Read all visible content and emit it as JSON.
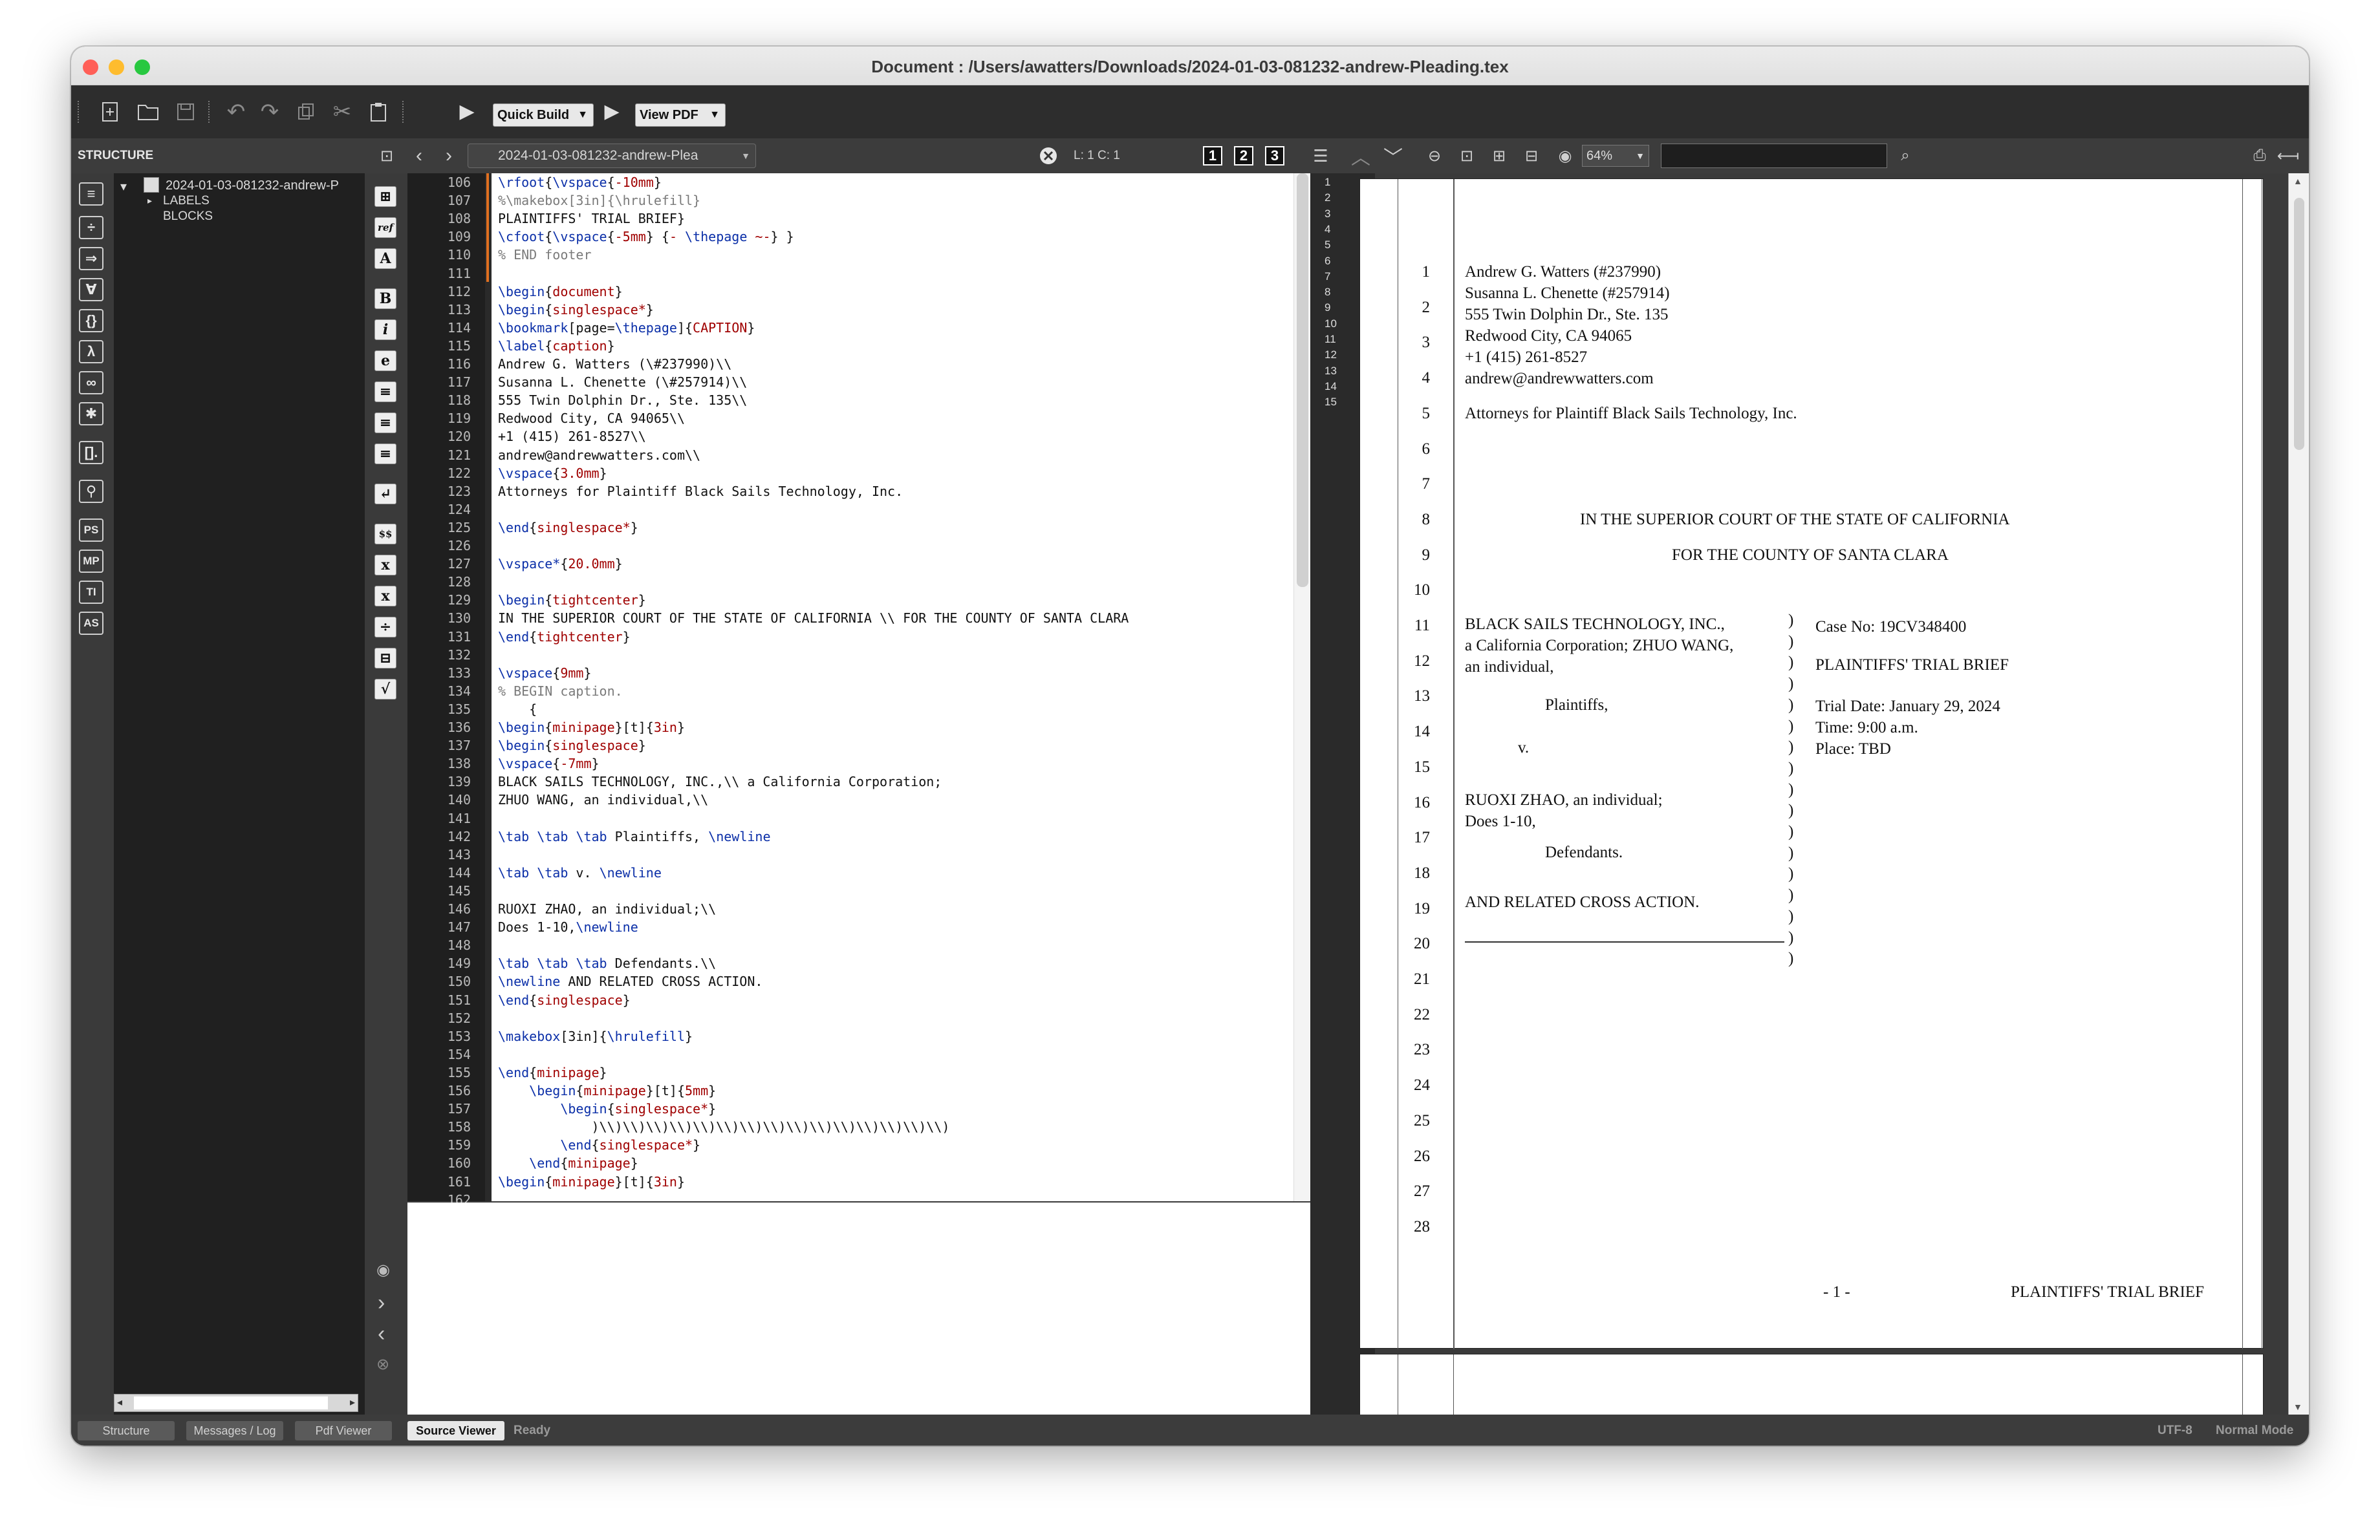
{
  "window": {
    "title": "Document : /Users/awatters/Downloads/2024-01-03-081232-andrew-Pleading.tex"
  },
  "toolbar": {
    "quick_build": "Quick Build",
    "view_pdf": "View PDF"
  },
  "sidebar": {
    "header": "STRUCTURE",
    "tree": {
      "file": "2024-01-03-081232-andrew-P",
      "labels": "LABELS",
      "blocks": "BLOCKS"
    },
    "icons": [
      "≡",
      "÷",
      "⇒",
      "∀",
      "{}",
      "λ",
      "∞",
      "✱",
      "[].",
      "⚲",
      "PS",
      "MP",
      "TI",
      "AS"
    ]
  },
  "editor": {
    "file_tab": "2024-01-03-081232-andrew-Plea",
    "position": "L: 1 C: 1",
    "latex_icons": [
      "⊞",
      "ref",
      "A",
      "B",
      "i",
      "e",
      "≡",
      "≡",
      "≡",
      "↵",
      "$$",
      "x",
      "x",
      "÷",
      "⊟",
      "√"
    ],
    "lines": [
      {
        "n": "106",
        "t": "\\rfoot{\\vspace{-10mm}"
      },
      {
        "n": "107",
        "t": "%\\makebox[3in]{\\hrulefill}"
      },
      {
        "n": "108",
        "t": "PLAINTIFFS' TRIAL BRIEF}"
      },
      {
        "n": "109",
        "t": "\\cfoot{\\vspace{-5mm} {- \\thepage ~-} }"
      },
      {
        "n": "110",
        "t": "% END footer"
      },
      {
        "n": "111",
        "t": ""
      },
      {
        "n": "112",
        "t": "\\begin{document}"
      },
      {
        "n": "113",
        "t": "\\begin{singlespace*}"
      },
      {
        "n": "114",
        "t": "\\bookmark[page=\\thepage]{CAPTION}"
      },
      {
        "n": "115",
        "t": "\\label{caption}"
      },
      {
        "n": "116",
        "t": "Andrew G. Watters (\\#237990)\\\\"
      },
      {
        "n": "117",
        "t": "Susanna L. Chenette (\\#257914)\\\\"
      },
      {
        "n": "118",
        "t": "555 Twin Dolphin Dr., Ste. 135\\\\"
      },
      {
        "n": "119",
        "t": "Redwood City, CA 94065\\\\"
      },
      {
        "n": "120",
        "t": "+1 (415) 261-8527\\\\"
      },
      {
        "n": "121",
        "t": "andrew@andrewwatters.com\\\\"
      },
      {
        "n": "122",
        "t": "\\vspace{3.0mm}"
      },
      {
        "n": "123",
        "t": "Attorneys for Plaintiff Black Sails Technology, Inc."
      },
      {
        "n": "124",
        "t": ""
      },
      {
        "n": "125",
        "t": "\\end{singlespace*}"
      },
      {
        "n": "126",
        "t": ""
      },
      {
        "n": "127",
        "t": "\\vspace*{20.0mm}"
      },
      {
        "n": "128",
        "t": ""
      },
      {
        "n": "129",
        "t": "\\begin{tightcenter}"
      },
      {
        "n": "130",
        "t": "IN THE SUPERIOR COURT OF THE STATE OF CALIFORNIA \\\\ FOR THE COUNTY OF SANTA CLARA"
      },
      {
        "n": "131",
        "t": "\\end{tightcenter}"
      },
      {
        "n": "132",
        "t": ""
      },
      {
        "n": "133",
        "t": "\\vspace{9mm}"
      },
      {
        "n": "134",
        "t": "% BEGIN caption."
      },
      {
        "n": "135",
        "t": "    {"
      },
      {
        "n": "136",
        "t": "\\begin{minipage}[t]{3in}"
      },
      {
        "n": "137",
        "t": "\\begin{singlespace}"
      },
      {
        "n": "138",
        "t": "\\vspace{-7mm}"
      },
      {
        "n": "139",
        "t": "BLACK SAILS TECHNOLOGY, INC.,\\\\ a California Corporation;"
      },
      {
        "n": "140",
        "t": "ZHUO WANG, an individual,\\\\"
      },
      {
        "n": "141",
        "t": ""
      },
      {
        "n": "142",
        "t": "\\tab \\tab \\tab Plaintiffs, \\newline"
      },
      {
        "n": "143",
        "t": ""
      },
      {
        "n": "144",
        "t": "\\tab \\tab v. \\newline"
      },
      {
        "n": "145",
        "t": ""
      },
      {
        "n": "146",
        "t": "RUOXI ZHAO, an individual;\\\\"
      },
      {
        "n": "147",
        "t": "Does 1-10,\\newline"
      },
      {
        "n": "148",
        "t": ""
      },
      {
        "n": "149",
        "t": "\\tab \\tab \\tab Defendants.\\\\"
      },
      {
        "n": "150",
        "t": "\\newline AND RELATED CROSS ACTION."
      },
      {
        "n": "151",
        "t": "\\end{singlespace}"
      },
      {
        "n": "152",
        "t": ""
      },
      {
        "n": "153",
        "t": "\\makebox[3in]{\\hrulefill}"
      },
      {
        "n": "154",
        "t": ""
      },
      {
        "n": "155",
        "t": "\\end{minipage}"
      },
      {
        "n": "156",
        "t": "    \\begin{minipage}[t]{5mm}"
      },
      {
        "n": "157",
        "t": "        \\begin{singlespace*}"
      },
      {
        "n": "158",
        "t": "            )\\\\)\\\\)\\\\)\\\\)\\\\)\\\\)\\\\)\\\\)\\\\)\\\\)\\\\)\\\\)\\\\)\\\\)\\\\)"
      },
      {
        "n": "159",
        "t": "        \\end{singlespace*}"
      },
      {
        "n": "160",
        "t": "    \\end{minipage}"
      },
      {
        "n": "161",
        "t": "\\begin{minipage}[t]{3in}"
      },
      {
        "n": "162",
        "t": ""
      }
    ]
  },
  "pdf": {
    "zoom": "64%",
    "outline_numbers": [
      "1",
      "2",
      "3",
      "4",
      "5",
      "6",
      "7",
      "8",
      "9",
      "10",
      "11",
      "12",
      "13",
      "14",
      "15"
    ],
    "line_numbers": [
      "1",
      "2",
      "3",
      "4",
      "5",
      "6",
      "7",
      "8",
      "9",
      "10",
      "11",
      "12",
      "13",
      "14",
      "15",
      "16",
      "17",
      "18",
      "19",
      "20",
      "21",
      "22",
      "23",
      "24",
      "25",
      "26",
      "27",
      "28"
    ],
    "attorney": [
      "Andrew G. Watters (#237990)",
      "Susanna L. Chenette (#257914)",
      "555 Twin Dolphin Dr., Ste. 135",
      "Redwood City, CA 94065",
      "+1 (415) 261-8527",
      "andrew@andrewwatters.com"
    ],
    "attorneys_for": "Attorneys for Plaintiff Black Sails Technology, Inc.",
    "court1": "IN THE SUPERIOR COURT OF THE STATE OF CALIFORNIA",
    "court2": "FOR THE COUNTY OF SANTA CLARA",
    "plaintiff1": "BLACK SAILS TECHNOLOGY, INC.,",
    "plaintiff2": "a California Corporation; ZHUO WANG,",
    "plaintiff3": "an individual,",
    "plaintiffs_label": "Plaintiffs,",
    "versus": "v.",
    "defendant1": "RUOXI ZHAO, an individual;",
    "defendant2": "Does 1-10,",
    "defendants_label": "Defendants.",
    "cross": "AND RELATED CROSS ACTION.",
    "case_no": "Case No: 19CV348400",
    "doc_title": "PLAINTIFFS' TRIAL BRIEF",
    "trial_date": "Trial Date: January 29, 2024",
    "time": "Time: 9:00 a.m.",
    "place": "Place: TBD",
    "footer_page": "- 1 -",
    "footer_title": "PLAINTIFFS' TRIAL BRIEF"
  },
  "bottom": {
    "tabs": [
      "Structure",
      "Messages / Log",
      "Pdf Viewer",
      "Source Viewer"
    ],
    "status": "Ready",
    "encoding": "UTF-8",
    "mode": "Normal Mode"
  }
}
